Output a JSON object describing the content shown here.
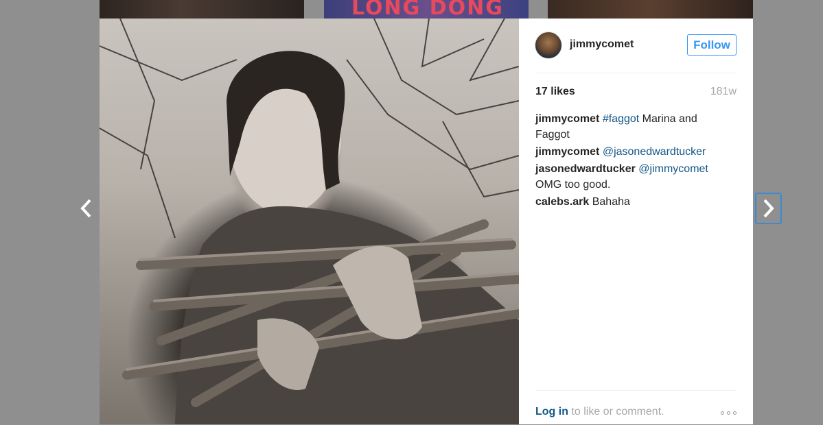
{
  "post": {
    "username": "jimmycomet",
    "follow_label": "Follow",
    "likes": "17 likes",
    "age": "181w"
  },
  "comments": [
    {
      "user": "jimmycomet",
      "link": "#faggot",
      "text": " Marina and Faggot"
    },
    {
      "user": "jimmycomet",
      "link": "@jasonedwardtucker",
      "text": ""
    },
    {
      "user": "jasonedwardtucker",
      "link": "@jimmycomet",
      "text": " OMG too good."
    },
    {
      "user": "calebs.ark",
      "link": "",
      "text": "Bahaha"
    }
  ],
  "footer": {
    "login_link": "Log in",
    "login_rest": " to like or comment."
  },
  "background": {
    "thumb_text": "LONG DONG"
  },
  "colors": {
    "link": "#125688",
    "follow_accent": "#3897f0",
    "muted": "#a5a7aa",
    "overlay": "#8f8f8f"
  },
  "icons": {
    "prev": "chevron-left-icon",
    "next": "chevron-right-icon",
    "more": "ellipsis-icon"
  }
}
